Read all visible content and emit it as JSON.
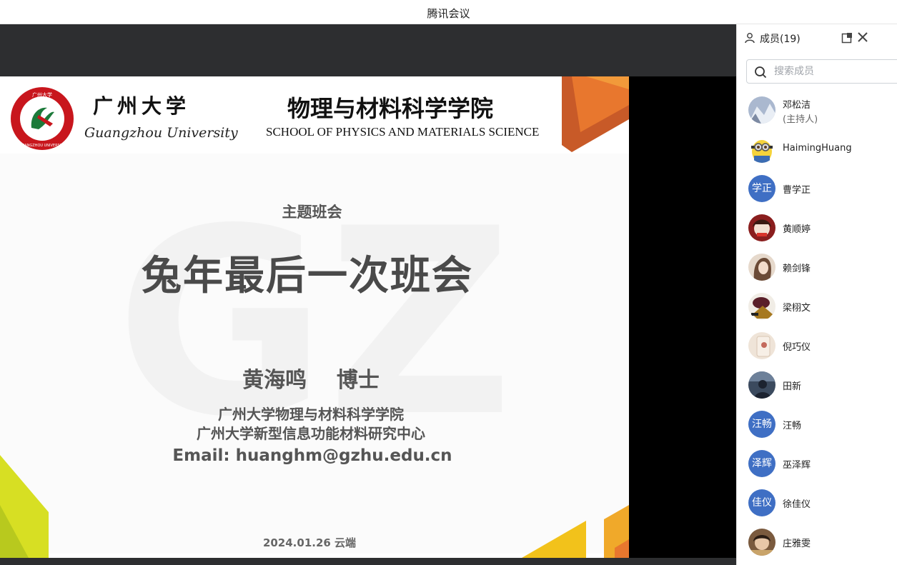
{
  "app": {
    "title": "腾讯会议"
  },
  "slide": {
    "university_cn": "广州大学",
    "university_en": "Guangzhou University",
    "school_cn": "物理与材料科学学院",
    "school_en": "SCHOOL OF PHYSICS AND MATERIALS SCIENCE",
    "subtitle": "主题班会",
    "main_title": "兔年最后一次班会",
    "presenter": "黄海鸣    博士",
    "affiliation_1": "广州大学物理与材料科学学院",
    "affiliation_2": "广州大学新型信息功能材料研究中心",
    "email": "Email: huanghm@gzhu.edu.cn",
    "date": "2024.01.26 云端",
    "logo_text": "GUANGZHOU UNIVERSITY",
    "logo_ring_text": "广州大学",
    "watermark": "GZ",
    "logo_color": "#c8161d",
    "accent_orange": "#e8772e",
    "accent_yellow": "#f2c21b",
    "accent_green": "#d7df23"
  },
  "members_panel": {
    "title": "成员(19)",
    "search_placeholder": "搜索成员",
    "members": [
      {
        "name": "邓松洁",
        "role": "(主持人)",
        "avatar": "photo-snow"
      },
      {
        "name": "HaimingHuang",
        "role": "",
        "avatar": "photo-minion"
      },
      {
        "name": "曹学正",
        "role": "",
        "avatar": "text",
        "initials": "学正"
      },
      {
        "name": "黄顺婷",
        "role": "",
        "avatar": "photo-red"
      },
      {
        "name": "赖剑锋",
        "role": "",
        "avatar": "photo-girl"
      },
      {
        "name": "梁栩文",
        "role": "",
        "avatar": "photo-dark"
      },
      {
        "name": "倪巧仪",
        "role": "",
        "avatar": "photo-beige"
      },
      {
        "name": "田新",
        "role": "",
        "avatar": "photo-night"
      },
      {
        "name": "汪畅",
        "role": "",
        "avatar": "text",
        "initials": "汪畅"
      },
      {
        "name": "巫泽辉",
        "role": "",
        "avatar": "text",
        "initials": "泽辉"
      },
      {
        "name": "徐佳仪",
        "role": "",
        "avatar": "text",
        "initials": "佳仪"
      },
      {
        "name": "庄雅雯",
        "role": "",
        "avatar": "photo-kid"
      }
    ]
  }
}
